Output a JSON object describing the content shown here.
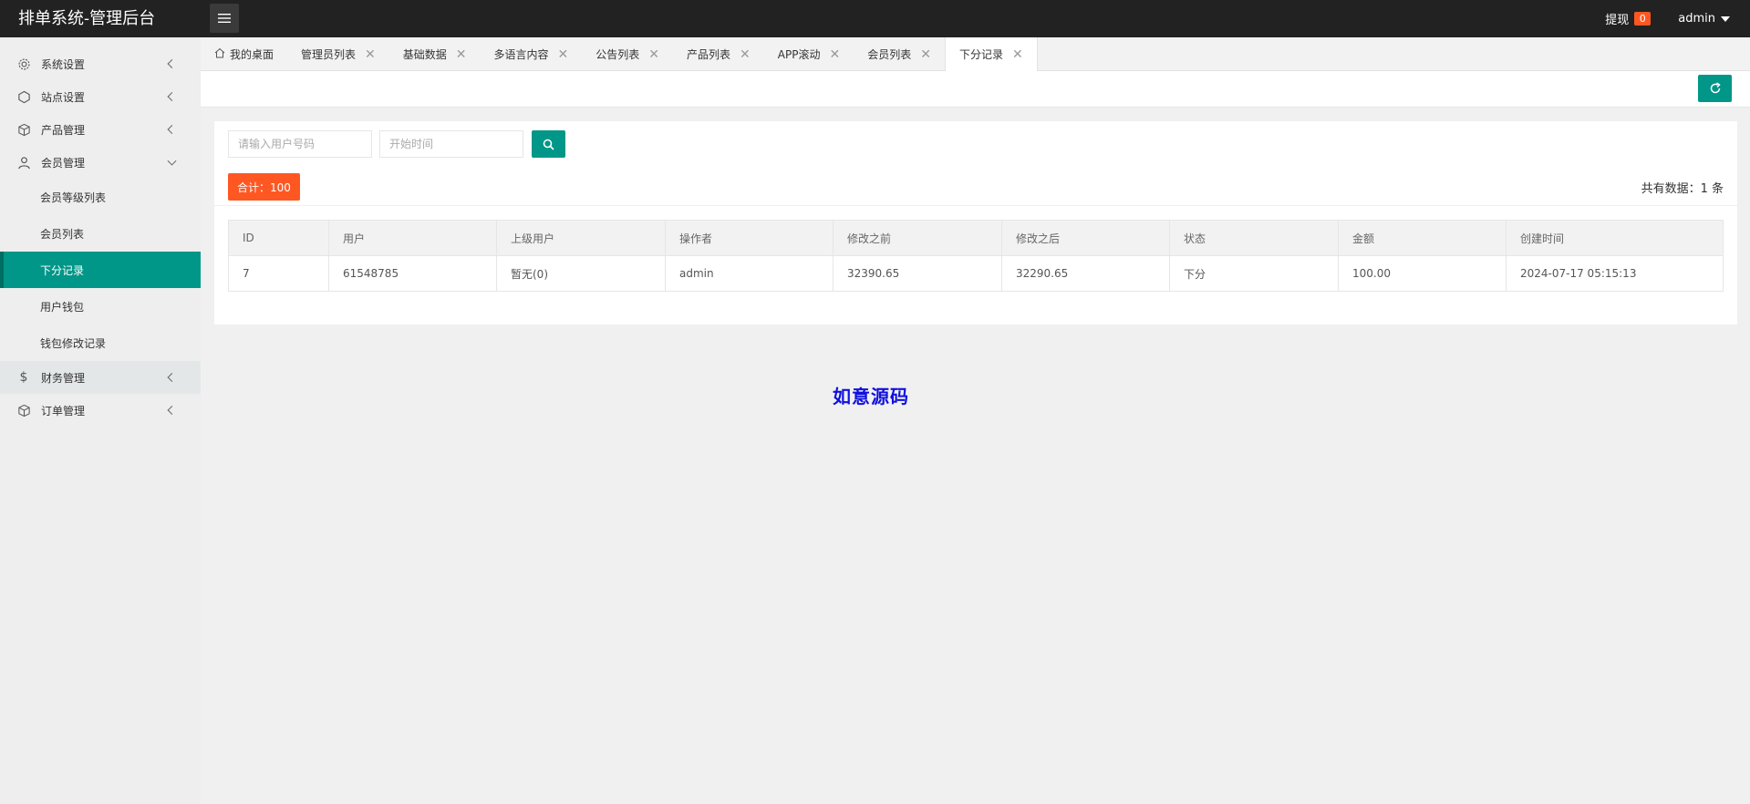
{
  "header": {
    "title": "排单系统-管理后台",
    "withdraw_label": "提现",
    "withdraw_count": "0",
    "user_name": "admin"
  },
  "sidebar": {
    "items": [
      {
        "label": "系统设置",
        "icon": "gear-icon"
      },
      {
        "label": "站点设置",
        "icon": "cube-outline-icon"
      },
      {
        "label": "产品管理",
        "icon": "box-icon"
      },
      {
        "label": "会员管理",
        "icon": "user-icon"
      },
      {
        "label": "财务管理",
        "icon": "dollar-icon"
      },
      {
        "label": "订单管理",
        "icon": "box-icon"
      }
    ],
    "member_sub": [
      "会员等级列表",
      "会员列表",
      "下分记录",
      "用户钱包",
      "钱包修改记录"
    ]
  },
  "tabs": [
    "我的桌面",
    "管理员列表",
    "基础数据",
    "多语言内容",
    "公告列表",
    "产品列表",
    "APP滚动",
    "会员列表",
    "下分记录"
  ],
  "search": {
    "user_placeholder": "请输入用户号码",
    "time_placeholder": "开始时间"
  },
  "summary": {
    "total": "合计：100",
    "count": "共有数据：1 条"
  },
  "table": {
    "headers": [
      "ID",
      "用户",
      "上级用户",
      "操作者",
      "修改之前",
      "修改之后",
      "状态",
      "金额",
      "创建时间"
    ],
    "rows": [
      [
        "7",
        "61548785",
        "暂无(0)",
        "admin",
        "32390.65",
        "32290.65",
        "下分",
        "100.00",
        "2024-07-17 05:15:13"
      ]
    ]
  },
  "watermark": "如意源码",
  "colors": {
    "accent": "#009688",
    "badge": "#ff5722",
    "header_bg": "#222222"
  }
}
